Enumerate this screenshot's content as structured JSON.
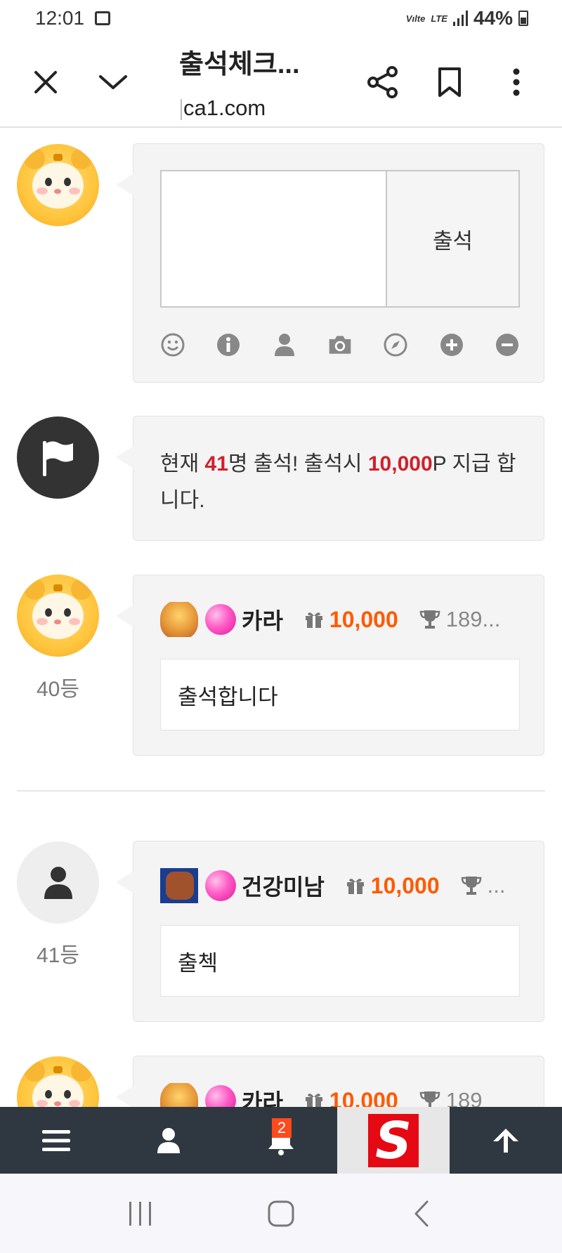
{
  "status_bar": {
    "time": "12:01",
    "network_small": "Vılte",
    "lte": "LTE",
    "battery": "44%"
  },
  "browser": {
    "title": "출석체크...",
    "url": "ca1.com"
  },
  "compose": {
    "attend_button": "출석",
    "tools": [
      "smile-icon",
      "info-icon",
      "user-icon",
      "camera-icon",
      "compass-icon",
      "plus-circle-icon",
      "minus-circle-icon"
    ]
  },
  "notice": {
    "prefix": "현재 ",
    "count": "41",
    "middle": "명 출석! 출석시 ",
    "points": "10,000",
    "suffix": "P 지급 합니다."
  },
  "entries": [
    {
      "rank": "40등",
      "username": "카라",
      "points": "10,000",
      "trophy": "189...",
      "message": "출석합니다"
    },
    {
      "rank": "41등",
      "username": "건강미남",
      "points": "10,000",
      "trophy": "...",
      "message": "출첵"
    },
    {
      "rank": "",
      "username": "카라",
      "points": "10,000",
      "trophy": "189",
      "message": ""
    }
  ],
  "bottom_nav": {
    "notification_count": "2",
    "logo_letter": "S"
  },
  "colors": {
    "accent_red": "#d1202c",
    "points_orange": "#ff5a00",
    "nav_bg": "#2f3740"
  }
}
